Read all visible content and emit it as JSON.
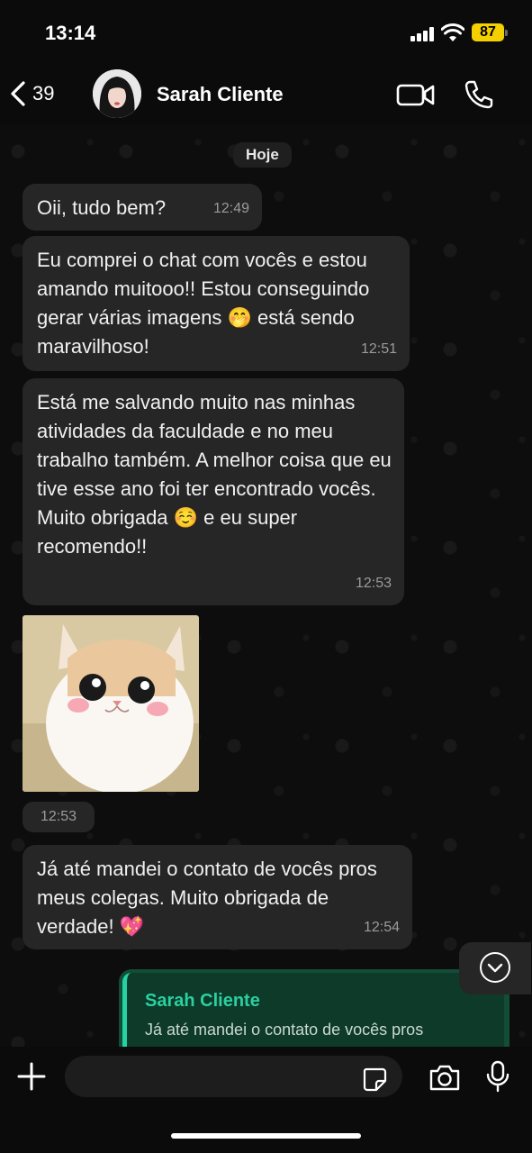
{
  "status_bar": {
    "time": "13:14",
    "battery": "87"
  },
  "header": {
    "back_count": "39",
    "contact_name": "Sarah Cliente"
  },
  "chat": {
    "date_label": "Hoje",
    "messages": [
      {
        "text": "Oii, tudo bem?",
        "time": "12:49"
      },
      {
        "text": "Eu comprei o chat com vocês e estou amando muitooo!! Estou conseguindo gerar várias imagens 🤭 está sendo maravilhoso!",
        "time": "12:51"
      },
      {
        "text": "Está me salvando muito nas minhas atividades da faculdade e no meu trabalho também. A melhor coisa que eu tive esse ano foi ter encontrado vocês. Muito obrigada ☺️ e eu super recomendo!!",
        "time": "12:53"
      },
      {
        "image": "cat-photo",
        "time": "12:53"
      },
      {
        "text": "Já até mandei o contato de vocês pros meus colegas. Muito obrigada de verdade! 💖",
        "time": "12:54"
      }
    ],
    "reply_quote": {
      "name": "Sarah Cliente",
      "text": "Já até mandei o contato de vocês pros"
    }
  },
  "composer": {
    "placeholder": ""
  },
  "colors": {
    "background": "#0b0b0b",
    "bubble": "#262626",
    "outgoing": "#134d37",
    "accent": "#25d3a1",
    "battery": "#f5d000"
  }
}
